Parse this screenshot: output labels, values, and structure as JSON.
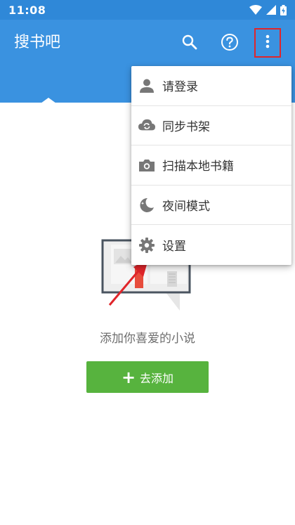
{
  "status_bar": {
    "time": "11:08"
  },
  "app_bar": {
    "title": "搜书吧"
  },
  "empty_state": {
    "message": "添加你喜爱的小说",
    "add_button_label": "去添加",
    "add_button_plus": "+"
  },
  "menu": {
    "items": [
      {
        "label": "请登录",
        "icon": "person-icon"
      },
      {
        "label": "同步书架",
        "icon": "cloud-sync-icon"
      },
      {
        "label": "扫描本地书籍",
        "icon": "camera-icon"
      },
      {
        "label": "夜间模式",
        "icon": "night-mode-icon"
      },
      {
        "label": "设置",
        "icon": "gear-icon"
      }
    ]
  },
  "colors": {
    "primary": "#3a92e0",
    "status_bar": "#2f88d8",
    "accent_green": "#57b33e",
    "highlight_red": "#e0252a"
  }
}
